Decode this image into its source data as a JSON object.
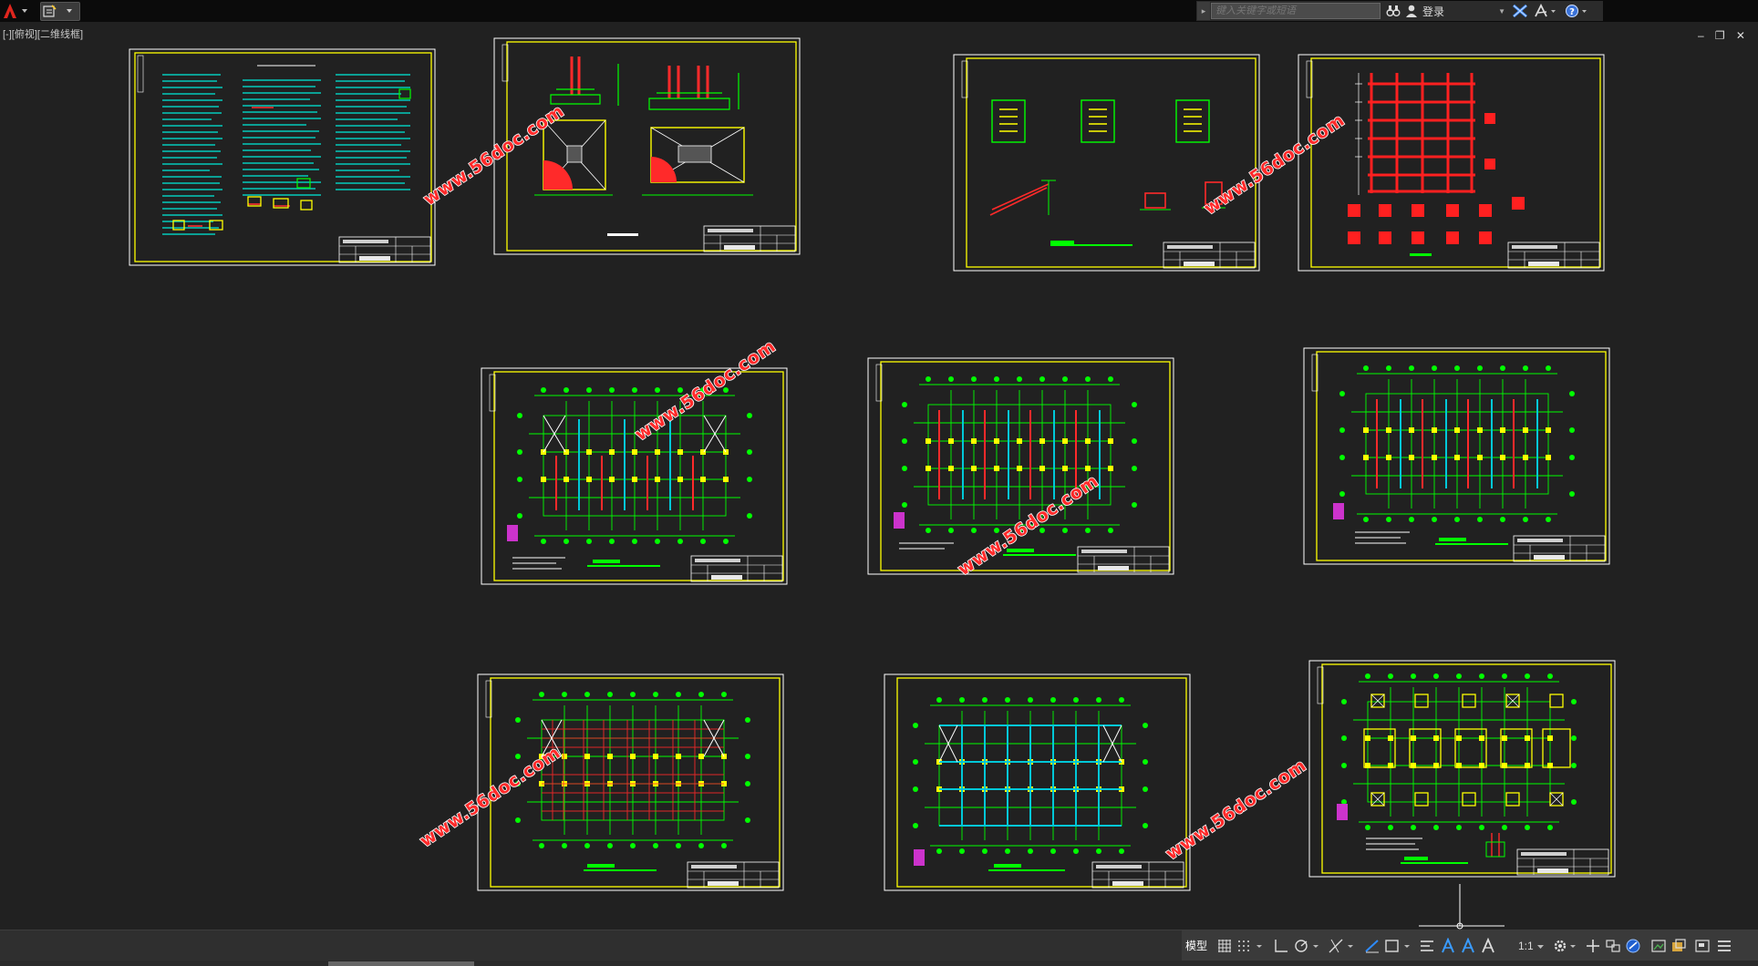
{
  "app": {
    "name": "AutoCAD"
  },
  "search": {
    "placeholder": "键入关键字或短语"
  },
  "login": {
    "label": "登录"
  },
  "viewport": {
    "label": "[-][俯视][二维线框]"
  },
  "watermark": {
    "text": "www.56doc.com"
  },
  "status": {
    "model_label": "模型",
    "scale_label": "1:1"
  },
  "colors": {
    "sheet_border": "#ffff00",
    "green": "#00ff00",
    "red": "#ff2020",
    "cyan": "#00e0e0",
    "background": "#212121"
  },
  "icons": [
    "autocad-logo-icon",
    "quick-access-icon",
    "search-binoculars-icon",
    "user-icon",
    "exchange-icon",
    "a360-icon",
    "help-icon",
    "grid-icon",
    "snap-icon",
    "ortho-icon",
    "polar-icon",
    "osnap-icon",
    "lineweight-icon",
    "annotation-icon",
    "workspace-gear-icon",
    "customize-icon"
  ]
}
